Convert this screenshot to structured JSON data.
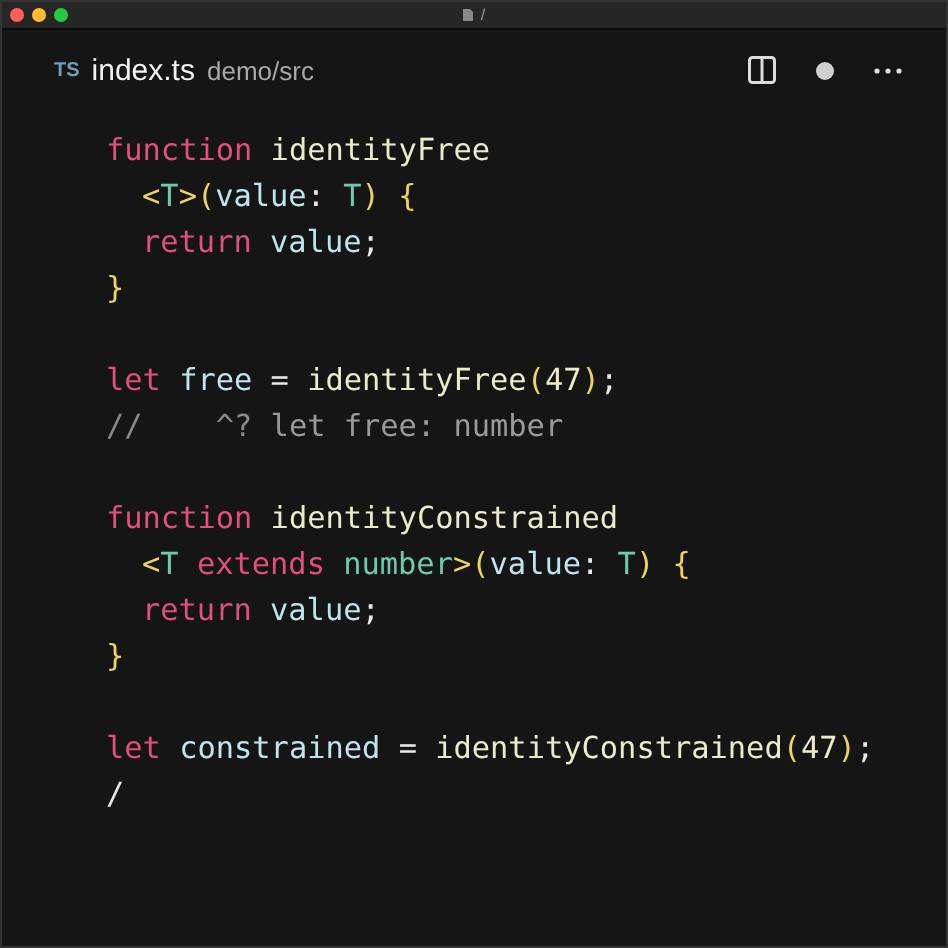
{
  "window": {
    "title": "/"
  },
  "tab": {
    "language": "TS",
    "filename": "index.ts",
    "path": "demo/src",
    "modified": true
  },
  "code_blocks": [
    [
      {
        "indented": false,
        "tokens": [
          {
            "kind": "keyword",
            "text": "function"
          },
          {
            "kind": "function",
            "text": " identityFree"
          }
        ]
      },
      {
        "indented": true,
        "tokens": [
          {
            "kind": "bracket",
            "text": "<"
          },
          {
            "kind": "type",
            "text": "T"
          },
          {
            "kind": "bracket",
            "text": ">("
          },
          {
            "kind": "variable",
            "text": "value"
          },
          {
            "kind": "punct",
            "text": ": "
          },
          {
            "kind": "type",
            "text": "T"
          },
          {
            "kind": "bracket",
            "text": ")"
          },
          {
            "kind": "bracket",
            "text": " {"
          }
        ]
      },
      {
        "indented": true,
        "tokens": [
          {
            "kind": "keyword",
            "text": "return"
          },
          {
            "kind": "variable",
            "text": " value"
          },
          {
            "kind": "punct",
            "text": ";"
          }
        ]
      },
      {
        "indented": false,
        "tokens": [
          {
            "kind": "bracket",
            "text": "}"
          }
        ]
      }
    ],
    [
      {
        "indented": false,
        "tokens": [
          {
            "kind": "keyword",
            "text": "let"
          },
          {
            "kind": "variable",
            "text": " free"
          },
          {
            "kind": "punct",
            "text": " = "
          },
          {
            "kind": "function",
            "text": "identityFree"
          },
          {
            "kind": "bracket",
            "text": "("
          },
          {
            "kind": "number",
            "text": "47"
          },
          {
            "kind": "bracket",
            "text": ")"
          },
          {
            "kind": "punct",
            "text": ";"
          }
        ]
      },
      {
        "indented": false,
        "tokens": [
          {
            "kind": "comment",
            "text": "//    ^? "
          },
          {
            "kind": "hint",
            "text": "let free: number"
          }
        ]
      }
    ],
    [
      {
        "indented": false,
        "tokens": [
          {
            "kind": "keyword",
            "text": "function"
          },
          {
            "kind": "function",
            "text": " identityConstrained"
          }
        ]
      },
      {
        "indented": true,
        "tokens": [
          {
            "kind": "bracket",
            "text": "<"
          },
          {
            "kind": "type",
            "text": "T"
          },
          {
            "kind": "keyword",
            "text": " extends"
          },
          {
            "kind": "type",
            "text": " number"
          },
          {
            "kind": "bracket",
            "text": ">("
          },
          {
            "kind": "variable",
            "text": "value"
          },
          {
            "kind": "punct",
            "text": ": "
          },
          {
            "kind": "type",
            "text": "T"
          },
          {
            "kind": "bracket",
            "text": ")"
          },
          {
            "kind": "bracket",
            "text": " {"
          }
        ]
      },
      {
        "indented": true,
        "tokens": [
          {
            "kind": "keyword",
            "text": "return"
          },
          {
            "kind": "variable",
            "text": " value"
          },
          {
            "kind": "punct",
            "text": ";"
          }
        ]
      },
      {
        "indented": false,
        "tokens": [
          {
            "kind": "bracket",
            "text": "}"
          }
        ]
      }
    ],
    [
      {
        "indented": false,
        "tokens": [
          {
            "kind": "keyword",
            "text": "let"
          },
          {
            "kind": "variable",
            "text": " constrained"
          },
          {
            "kind": "punct",
            "text": " = "
          },
          {
            "kind": "function",
            "text": "identityConstrained"
          },
          {
            "kind": "bracket",
            "text": "("
          },
          {
            "kind": "number",
            "text": "47"
          },
          {
            "kind": "bracket",
            "text": ")"
          },
          {
            "kind": "punct",
            "text": ";"
          }
        ]
      },
      {
        "indented": false,
        "tokens": [
          {
            "kind": "punct",
            "text": "/"
          }
        ]
      }
    ]
  ]
}
